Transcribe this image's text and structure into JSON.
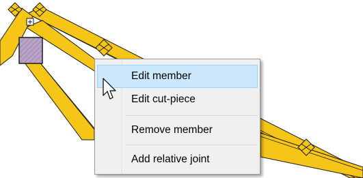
{
  "context_menu": {
    "items": [
      {
        "label": "Edit member",
        "highlighted": true
      },
      {
        "label": "Edit cut-piece",
        "highlighted": false
      },
      {
        "label": "Remove member",
        "highlighted": false
      },
      {
        "label": "Add relative joint",
        "highlighted": false
      }
    ]
  },
  "colors": {
    "member_fill": "#f5c518",
    "member_outline": "#1a1a1a",
    "plate_fill": "#f5c518",
    "selected_plate_fill": "#b9a2c8",
    "menu_bg": "#f0f0f0",
    "menu_highlight": "#cce8ff",
    "menu_highlight_border": "#99d1ff"
  },
  "icons": {
    "cursor": "arrow-pointer-icon",
    "joint": "connector-plate-icon",
    "handle": "plus-handle-icon"
  }
}
